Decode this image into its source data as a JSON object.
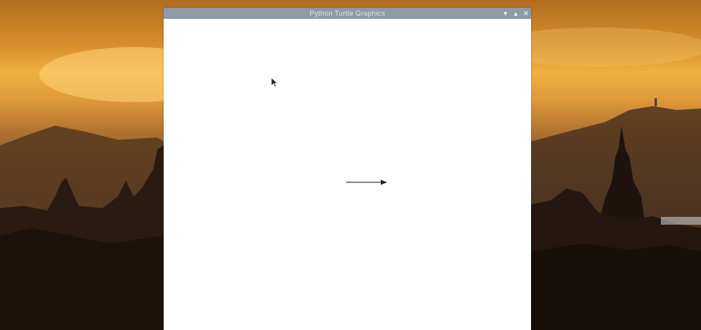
{
  "window": {
    "title": "Python Turtle Graphics",
    "buttons": {
      "minimize": "▾",
      "maximize": "▴",
      "close": "✕"
    }
  },
  "canvas": {
    "background": "#ffffff",
    "turtle_heading": "east"
  },
  "icons": {
    "cursor": "mouse-pointer-icon",
    "turtle": "turtle-arrow-icon"
  },
  "colors": {
    "titlebar": "#8e9aa6",
    "title_text": "#dfe6ec",
    "line": "#222222"
  }
}
